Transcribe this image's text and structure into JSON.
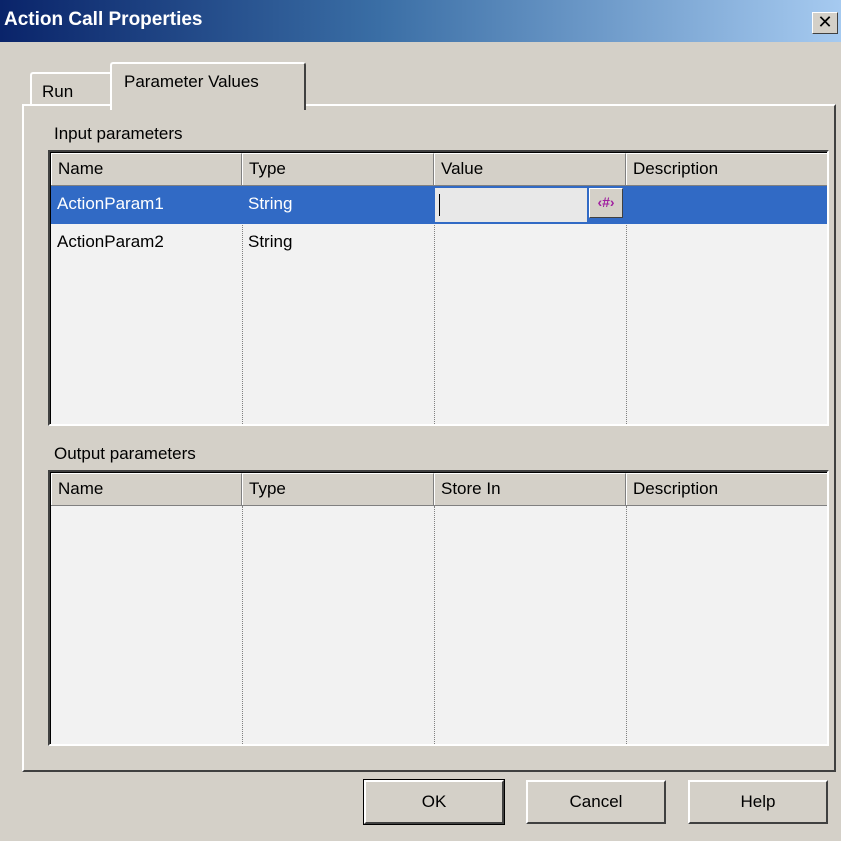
{
  "window": {
    "title": "Action Call Properties",
    "close_glyph": "✕"
  },
  "tabs": [
    {
      "label": "Run",
      "active": false
    },
    {
      "label": "Parameter Values",
      "active": true
    }
  ],
  "input_params": {
    "label": "Input parameters",
    "columns": [
      "Name",
      "Type",
      "Value",
      "Description"
    ],
    "rows": [
      {
        "name": "ActionParam1",
        "type": "String",
        "value": "",
        "description": "",
        "selected": true
      },
      {
        "name": "ActionParam2",
        "type": "String",
        "value": "",
        "description": "",
        "selected": false
      }
    ],
    "expression_button": "‹#›"
  },
  "output_params": {
    "label": "Output parameters",
    "columns": [
      "Name",
      "Type",
      "Store In",
      "Description"
    ],
    "rows": []
  },
  "buttons": {
    "ok": "OK",
    "cancel": "Cancel",
    "help": "Help"
  },
  "colors": {
    "selection": "#316ac5",
    "titlebar_start": "#0a246a",
    "titlebar_end": "#a6caf0",
    "face": "#d4d0c8"
  }
}
